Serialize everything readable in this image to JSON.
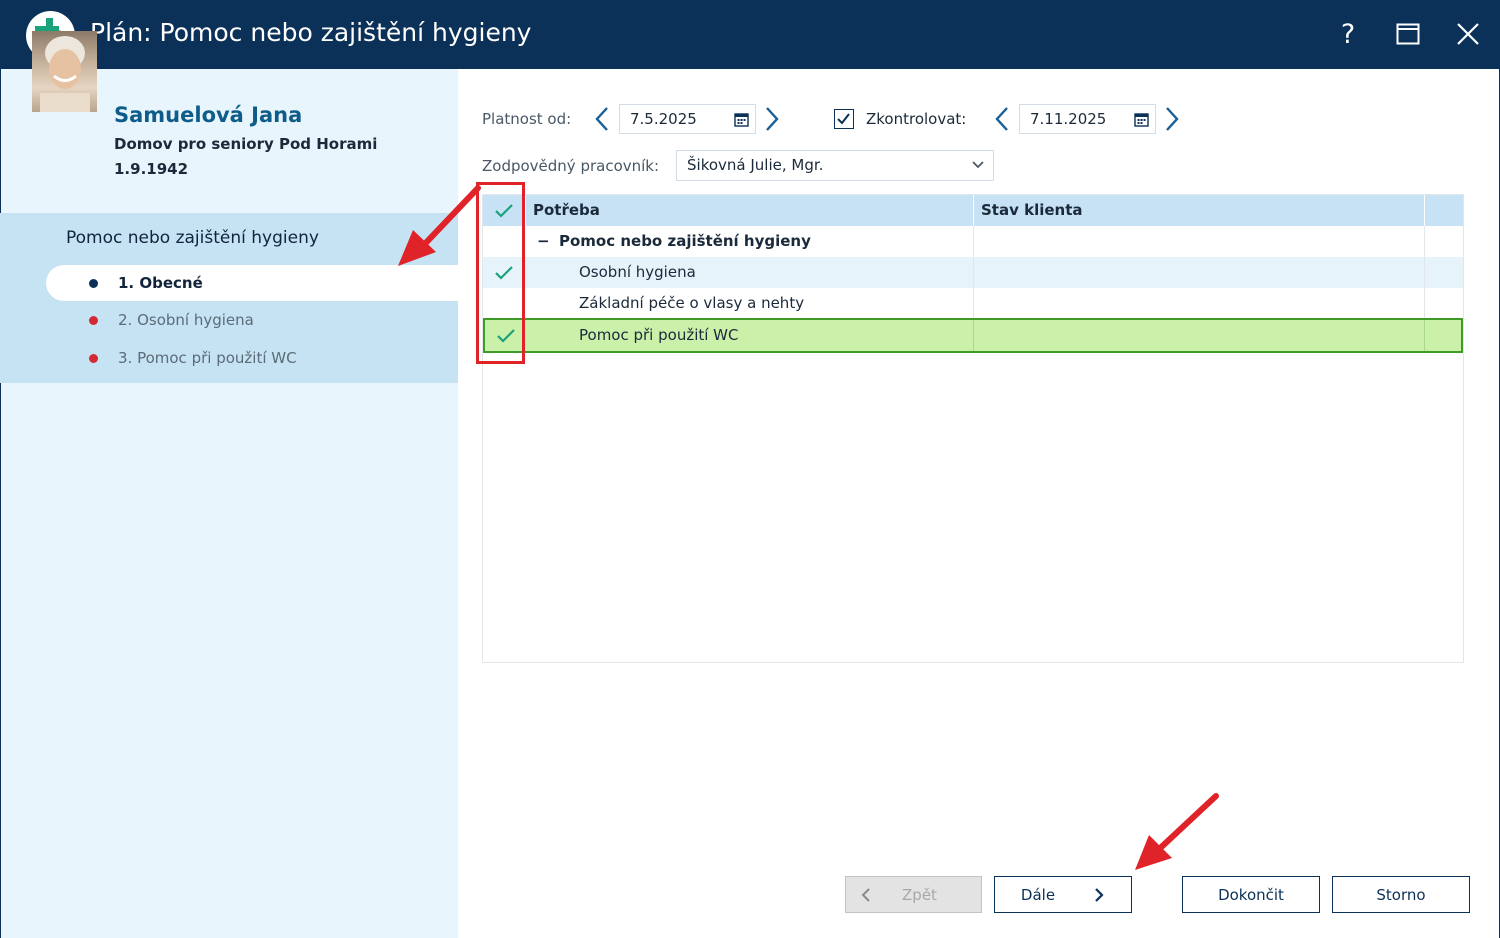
{
  "window": {
    "title": "Plán: Pomoc nebo zajištění hygieny",
    "help_label": "?"
  },
  "client": {
    "name": "Samuelová Jana",
    "organization": "Domov pro seniory Pod Horami",
    "birth_date": "1.9.1942"
  },
  "steps": {
    "title": "Pomoc nebo zajištění hygieny",
    "items": [
      {
        "label": "1. Obecné",
        "state": "active"
      },
      {
        "label": "2. Osobní hygiena",
        "state": "pending"
      },
      {
        "label": "3. Pomoc při použití WC",
        "state": "pending"
      }
    ]
  },
  "form": {
    "valid_from_label": "Platnost od:",
    "valid_from_value": "7.5.2025",
    "check_label": "Zkontrolovat:",
    "check_checked": true,
    "check_value": "7.11.2025",
    "worker_label": "Zodpovědný pracovník:",
    "worker_value": "Šikovná Julie, Mgr."
  },
  "grid": {
    "columns": [
      "Potřeba",
      "Stav klienta"
    ],
    "rows": [
      {
        "label": "Pomoc nebo zajištění hygieny",
        "group": true,
        "collapse_glyph": "−",
        "checked": false,
        "status": ""
      },
      {
        "label": "Osobní hygiena",
        "group": false,
        "checked": true,
        "status": ""
      },
      {
        "label": "Základní péče o vlasy a nehty",
        "group": false,
        "checked": false,
        "status": ""
      },
      {
        "label": "Pomoc při použití WC",
        "group": false,
        "checked": true,
        "selected": true,
        "status": ""
      }
    ]
  },
  "buttons": {
    "back": "Zpět",
    "next": "Dále",
    "finish": "Dokončit",
    "cancel": "Storno"
  },
  "colors": {
    "titlebar": "#0b3158",
    "sidebar": "#e9f5fc",
    "steps_panel": "#c5e3f3",
    "check": "#1aa37a",
    "pending_dot": "#d42a33",
    "selected_row": "#cbf0a9",
    "annotation": "#e02229"
  }
}
